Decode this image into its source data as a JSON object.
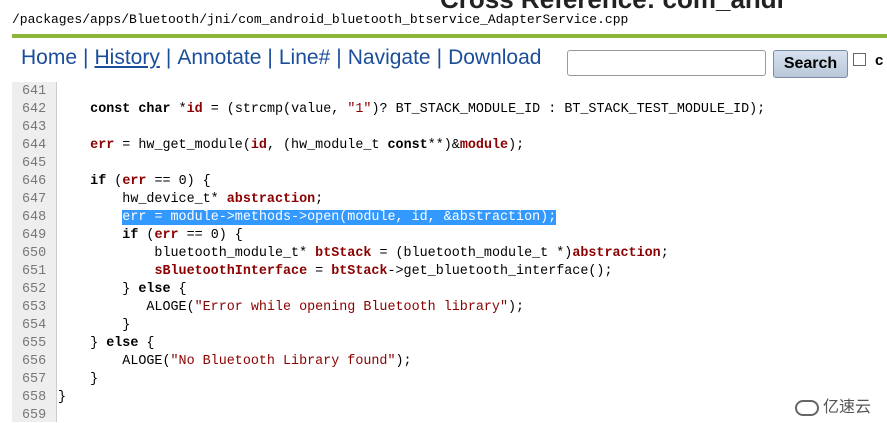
{
  "header": {
    "top_title": "Cross Reference: com_andr",
    "path": "/packages/apps/Bluetooth/jni/com_android_bluetooth_btservice_AdapterService.cpp"
  },
  "nav": {
    "links": [
      "Home",
      "History",
      "Annotate",
      "Line#",
      "Navigate",
      "Download"
    ],
    "separator": "|",
    "search_value": "",
    "search_button": "Search",
    "checkbox_label": "c"
  },
  "code": {
    "lines": [
      {
        "n": "641",
        "t": ""
      },
      {
        "n": "642",
        "t": "    const char *id = (strcmp(value, \"1\")? BT_STACK_MODULE_ID : BT_STACK_TEST_MODULE_ID);"
      },
      {
        "n": "643",
        "t": ""
      },
      {
        "n": "644",
        "t": "    err = hw_get_module(id, (hw_module_t const**)&module);"
      },
      {
        "n": "645",
        "t": ""
      },
      {
        "n": "646",
        "t": "    if (err == 0) {"
      },
      {
        "n": "647",
        "t": "        hw_device_t* abstraction;"
      },
      {
        "n": "648",
        "t": "        err = module->methods->open(module, id, &abstraction);"
      },
      {
        "n": "649",
        "t": "        if (err == 0) {"
      },
      {
        "n": "650",
        "t": "            bluetooth_module_t* btStack = (bluetooth_module_t *)abstraction;"
      },
      {
        "n": "651",
        "t": "            sBluetoothInterface = btStack->get_bluetooth_interface();"
      },
      {
        "n": "652",
        "t": "        } else {"
      },
      {
        "n": "653",
        "t": "           ALOGE(\"Error while opening Bluetooth library\");"
      },
      {
        "n": "654",
        "t": "        }"
      },
      {
        "n": "655",
        "t": "    } else {"
      },
      {
        "n": "656",
        "t": "        ALOGE(\"No Bluetooth Library found\");"
      },
      {
        "n": "657",
        "t": "    }"
      },
      {
        "n": "658",
        "t": "}"
      },
      {
        "n": "659",
        "t": ""
      }
    ],
    "highlight_line": "648"
  },
  "watermark": "亿速云"
}
